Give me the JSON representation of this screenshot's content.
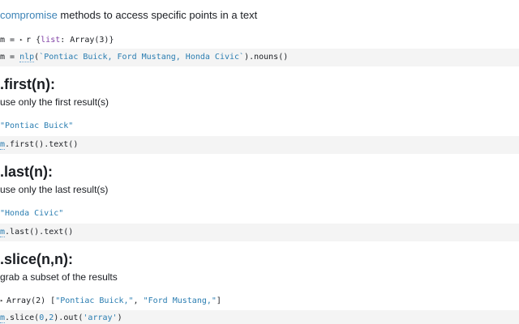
{
  "intro": {
    "link": "compromise",
    "text": " methods to access specific points in a text"
  },
  "cell0": {
    "out_var": "m",
    "out_eq": " = ",
    "out_caret": "▸",
    "out_obj": "r {",
    "out_key": "list",
    "out_rest": ": Array(3)}",
    "code_var": "m",
    "code_eq": " = ",
    "code_fn": "nlp",
    "code_open": "(",
    "code_str": "`Pontiac Buick, Ford Mustang, Honda Civic`",
    "code_rest": ").nouns()"
  },
  "first": {
    "heading": ".first(n):",
    "desc": "use only the first result(s)",
    "output": "\"Pontiac Buick\"",
    "code_var": "m",
    "code_rest": ".first().text()"
  },
  "last": {
    "heading": ".last(n):",
    "desc": "use only the last result(s)",
    "output": "\"Honda Civic\"",
    "code_var": "m",
    "code_rest": ".last().text()"
  },
  "slice": {
    "heading": ".slice(n,n):",
    "desc": "grab a subset of the results",
    "out_caret": "▸",
    "out_prefix": "Array(2) [",
    "out_item1": "\"Pontiac Buick,\"",
    "out_sep": ", ",
    "out_item2": "\"Ford Mustang,\"",
    "out_suffix": "]",
    "code_var": "m",
    "code_a": ".slice(",
    "code_n1": "0",
    "code_comma": ",",
    "code_n2": "2",
    "code_b": ").out(",
    "code_str": "'array'",
    "code_c": ")"
  }
}
